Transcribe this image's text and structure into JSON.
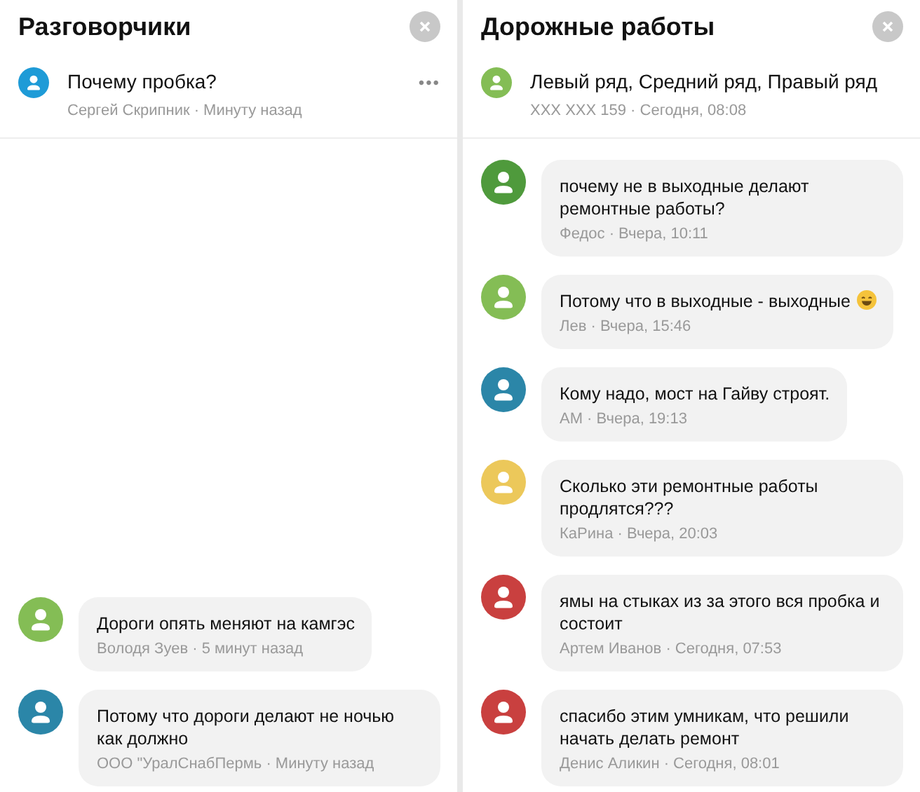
{
  "panels": [
    {
      "title": "Разговорчики",
      "topic": {
        "title": "Почему пробка?",
        "meta": "Сергей Скрипник · Минуту назад",
        "color": "#1e9bd7",
        "more": "•••"
      },
      "messages": [
        {
          "text": "Дороги опять меняют на камгэс",
          "meta": "Володя Зуев · 5 минут назад",
          "color": "#84bd55"
        },
        {
          "text": "Потому что дороги делают не ночью как должно",
          "meta": "ООО \"УралСнабПермь · Минуту назад",
          "color": "#2b86a8"
        }
      ]
    },
    {
      "title": "Дорожные работы",
      "topic": {
        "title": "Левый ряд, Средний ряд, Правый ряд",
        "meta": "XXX XXX 159 · Сегодня, 08:08",
        "color": "#84bd55"
      },
      "messages": [
        {
          "text": "почему не в выходные делают ремонтные работы?",
          "meta": "Федос · Вчера, 10:11",
          "color": "#4f9a3c"
        },
        {
          "text": "Потому что в выходные - выходные",
          "kind": "with-emoji",
          "meta": "Лев · Вчера, 15:46",
          "color": "#84bd55"
        },
        {
          "text": "Кому надо, мост на Гайву строят.",
          "meta": "АМ · Вчера, 19:13",
          "color": "#2b86a8"
        },
        {
          "text": "Сколько эти ремонтные работы продлятся???",
          "meta": "КаРина · Вчера, 20:03",
          "color": "#ecc85a"
        },
        {
          "text": "ямы на стыках из за этого вся пробка и состоит",
          "meta": "Артем Иванов · Сегодня, 07:53",
          "color": "#c9403f"
        },
        {
          "text": "спасибо этим умникам, что решили начать делать ремонт",
          "meta": "Денис Аликин · Сегодня, 08:01",
          "color": "#c9403f"
        }
      ]
    }
  ]
}
